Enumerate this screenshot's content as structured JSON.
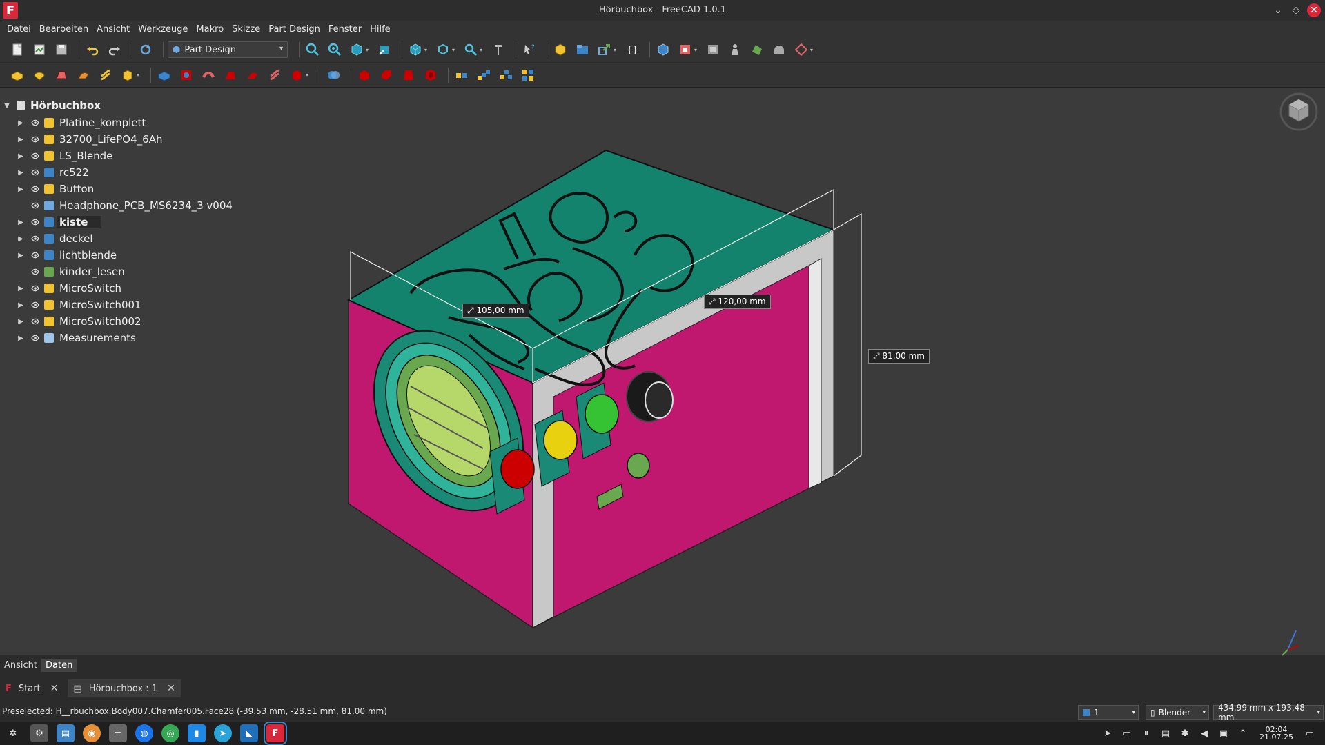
{
  "window": {
    "title": "Hörbuchbox - FreeCAD 1.0.1",
    "app_icon": "F"
  },
  "menu": [
    "Datei",
    "Bearbeiten",
    "Ansicht",
    "Werkzeuge",
    "Makro",
    "Skizze",
    "Part Design",
    "Fenster",
    "Hilfe"
  ],
  "toolbar": {
    "workbench": "Part Design"
  },
  "tree": {
    "root": "Hörbuchbox",
    "items": [
      {
        "label": "Platine_komplett",
        "icon": "part-icon",
        "expandable": true
      },
      {
        "label": "32700_LifePO4_6Ah",
        "icon": "part-icon",
        "expandable": true
      },
      {
        "label": "LS_Blende",
        "icon": "part-icon",
        "expandable": true
      },
      {
        "label": "rc522",
        "icon": "body-icon",
        "expandable": true
      },
      {
        "label": "Button",
        "icon": "part-icon",
        "expandable": true
      },
      {
        "label": "Headphone_PCB_MS6234_3 v004",
        "icon": "solid-icon",
        "expandable": false
      },
      {
        "label": "kiste",
        "icon": "body-icon",
        "expandable": true,
        "selected": true
      },
      {
        "label": "deckel",
        "icon": "body-icon",
        "expandable": true
      },
      {
        "label": "lichtblende",
        "icon": "body-icon",
        "expandable": true
      },
      {
        "label": "kinder_lesen",
        "icon": "image-icon",
        "expandable": false
      },
      {
        "label": "MicroSwitch",
        "icon": "part-icon",
        "expandable": true
      },
      {
        "label": "MicroSwitch001",
        "icon": "part-icon",
        "expandable": true
      },
      {
        "label": "MicroSwitch002",
        "icon": "part-icon",
        "expandable": true
      },
      {
        "label": "Measurements",
        "icon": "measure-icon",
        "expandable": true
      }
    ]
  },
  "measurements": {
    "width": "105,00 mm",
    "depth": "120,00 mm",
    "height": "81,00 mm"
  },
  "panel_tabs": [
    "Ansicht",
    "Daten"
  ],
  "doc_tabs": [
    {
      "label": "Start"
    },
    {
      "label": "Hörbuchbox : 1"
    }
  ],
  "status": {
    "text": "Preselected: H__rbuchbox.Body007.Chamfer005.Face28 (-39.53 mm, -28.51 mm, 81.00 mm)",
    "draw_style": "1",
    "navigation": "Blender",
    "dimensions": "434,99 mm x 193,48 mm"
  },
  "clock": {
    "time": "02:04",
    "date": "21.07.25"
  },
  "colors": {
    "box_magenta": "#c0176f",
    "lid_green": "#14836d",
    "panel_grey": "#c8c8c8",
    "bg": "#3b3b3b"
  }
}
